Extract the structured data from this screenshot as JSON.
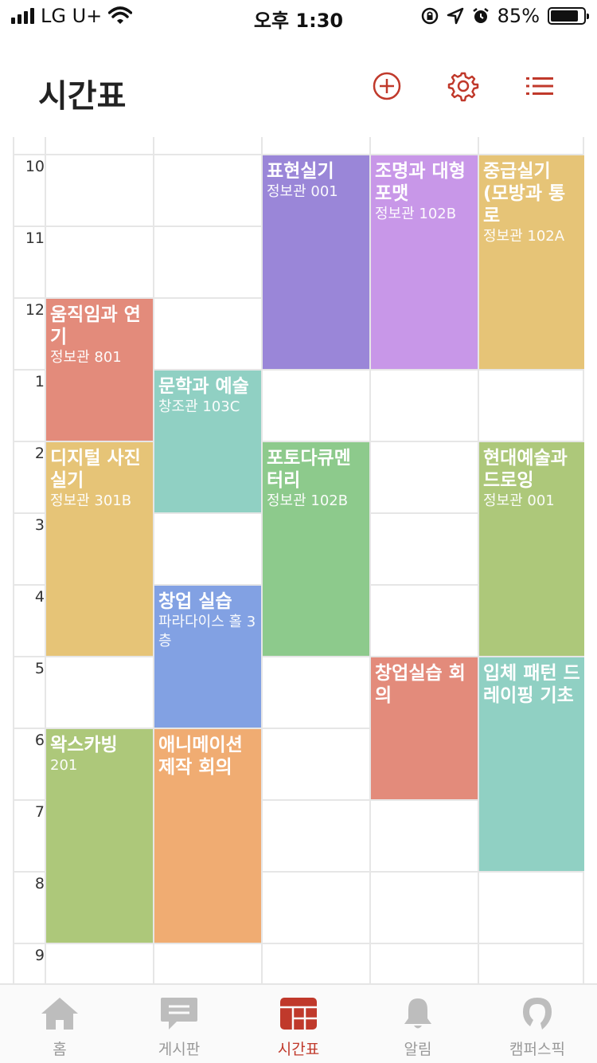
{
  "status_bar": {
    "carrier": "LG U+",
    "time": "오후 1:30",
    "battery": "85%"
  },
  "header": {
    "title": "시간표",
    "icons": [
      "add-circle-icon",
      "gear-icon",
      "list-icon"
    ]
  },
  "timetable": {
    "hours": [
      "10",
      "11",
      "12",
      "1",
      "2",
      "3",
      "4",
      "5",
      "6",
      "7",
      "8",
      "9"
    ],
    "courses": [
      {
        "name": "움직임과 연기",
        "room": "정보관 801",
        "day": 0,
        "start": 12,
        "end": 14,
        "color": "#e38b7b"
      },
      {
        "name": "디지털 사진 실기",
        "room": "정보관 301B",
        "day": 0,
        "start": 14,
        "end": 17,
        "color": "#e6c477"
      },
      {
        "name": "왁스카빙",
        "room": "201",
        "day": 0,
        "start": 18,
        "end": 21,
        "color": "#adc87a"
      },
      {
        "name": "문학과 예술",
        "room": "창조관 103C",
        "day": 1,
        "start": 13,
        "end": 15,
        "color": "#90d0c3"
      },
      {
        "name": "창업 실습",
        "room": "파라다이스 홀 3층",
        "day": 1,
        "start": 16,
        "end": 18,
        "color": "#82a1e3"
      },
      {
        "name": "애니메이션 제작 회의",
        "room": "",
        "day": 1,
        "start": 18,
        "end": 21,
        "color": "#f0ac72"
      },
      {
        "name": "표현실기",
        "room": "정보관 001",
        "day": 2,
        "start": 10,
        "end": 13,
        "color": "#9a86d8"
      },
      {
        "name": "포토다큐멘터리",
        "room": "정보관 102B",
        "day": 2,
        "start": 14,
        "end": 17,
        "color": "#8dca8c"
      },
      {
        "name": "조명과 대형포맷",
        "room": "정보관 102B",
        "day": 3,
        "start": 10,
        "end": 13,
        "color": "#c897e8"
      },
      {
        "name": "창업실습 회의",
        "room": "",
        "day": 3,
        "start": 17,
        "end": 19,
        "color": "#e38b7b"
      },
      {
        "name": "중급실기 (모방과 통로",
        "room": "정보관 102A",
        "day": 4,
        "start": 10,
        "end": 13,
        "color": "#e6c477"
      },
      {
        "name": "현대예술과 드로잉",
        "room": "정보관 001",
        "day": 4,
        "start": 14,
        "end": 17,
        "color": "#adc87a"
      },
      {
        "name": "입체 패턴 드레이핑 기초",
        "room": "",
        "day": 4,
        "start": 17,
        "end": 20,
        "color": "#90d0c3"
      }
    ]
  },
  "tab_bar": {
    "tabs": [
      {
        "label": "홈",
        "icon": "home-icon",
        "active": false
      },
      {
        "label": "게시판",
        "icon": "chat-icon",
        "active": false
      },
      {
        "label": "시간표",
        "icon": "timetable-icon",
        "active": true
      },
      {
        "label": "알림",
        "icon": "bell-icon",
        "active": false
      },
      {
        "label": "캠퍼스픽",
        "icon": "campuspick-icon",
        "active": false
      }
    ]
  },
  "colors": {
    "accent": "#c0392b",
    "inactive": "#bdbdbd"
  }
}
